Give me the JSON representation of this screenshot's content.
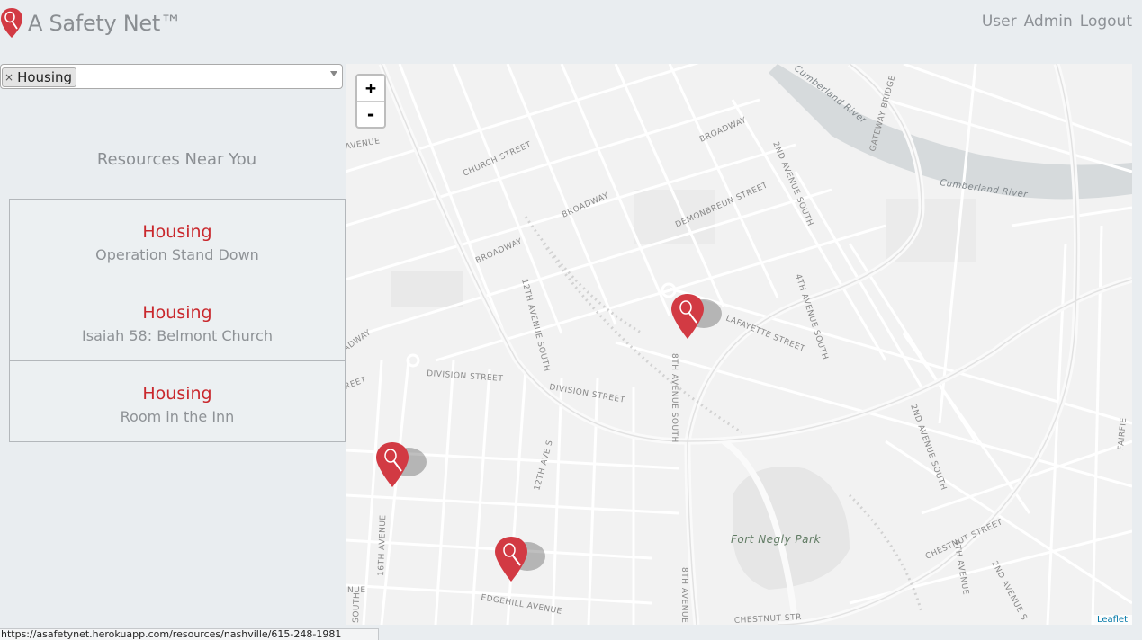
{
  "header": {
    "brand_name": "A Safety Net™",
    "nav": [
      "User",
      "Admin",
      "Logout"
    ]
  },
  "filter": {
    "selected": "Housing",
    "remove_glyph": "×"
  },
  "resources": {
    "heading": "Resources Near You",
    "items": [
      {
        "category": "Housing",
        "name": "Operation Stand Down"
      },
      {
        "category": "Housing",
        "name": "Isaiah 58: Belmont Church"
      },
      {
        "category": "Housing",
        "name": "Room in the Inn"
      }
    ]
  },
  "map": {
    "zoom_in": "+",
    "zoom_out": "-",
    "attribution": "Leaflet",
    "labels": {
      "cumberland_river_1": "Cumberland River",
      "cumberland_river_2": "Cumberland River",
      "church_street": "CHURCH STREET",
      "broadway_1": "BROADWAY",
      "broadway_2": "BROADWAY",
      "broadway_3": "BROADWAY",
      "demonbreun": "DEMONBREUN STREET",
      "second_ave_south_1": "2ND AVENUE SOUTH",
      "gateway_bridge": "GATEWAY BRIDGE",
      "twelfth_ave_south": "12TH AVENUE SOUTH",
      "lafayette": "LAFAYETTE STREET",
      "fourth_ave_south": "4TH AVENUE SOUTH",
      "division_street_1": "DIVISION STREET",
      "division_street_2": "DIVISION STREET",
      "eighth_ave_south": "8TH AVENUE SOUTH",
      "second_ave_south_2": "2ND AVENUE SOUTH",
      "twelfth_ave_s": "12TH AVE S",
      "sixteenth_ave": "16TH AVENUE",
      "fort_negly": "Fort Negly Park",
      "chestnut_1": "CHESTNUT STREET",
      "chestnut_2": "CHESTNUT STR",
      "fourth_ave": "4TH AVENUE",
      "second_ave": "2ND AVENUE S",
      "edgehill": "EDGEHILL AVENUE",
      "eighth_ave": "8TH AVENUE",
      "fairfield": "FAIRFIE",
      "avenue_left": "AVENUE",
      "street_left": "REET",
      "adway_left": "ADWAY",
      "nue_left": "NUE",
      "south_left": "SOUTH"
    }
  },
  "status_url": "https://asafetynet.herokuapp.com/resources/nashville/615-248-1981",
  "colors": {
    "accent": "#c9282d",
    "marker": "#d23a43"
  }
}
